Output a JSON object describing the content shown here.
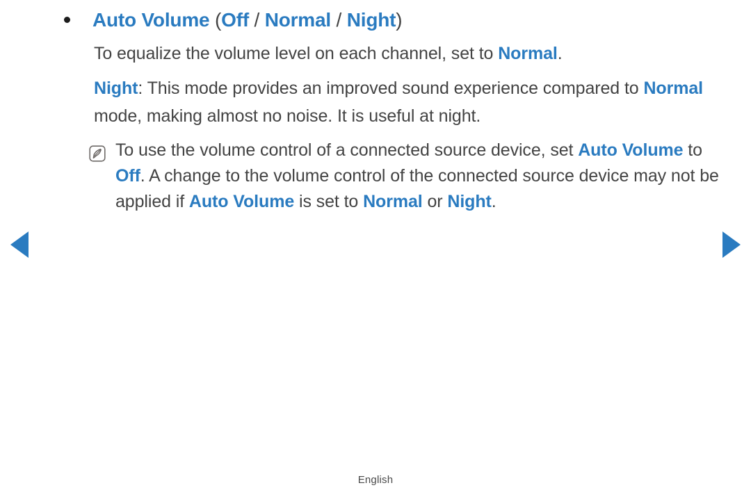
{
  "page": {
    "language_footer": "English",
    "accent_color": "#2a7bc0",
    "text_color": "#434343",
    "background_color": "#ffffff"
  },
  "bullet": {
    "dot": "•",
    "term": "Auto Volume",
    "open_paren": " (",
    "option_1": "Off",
    "sep_1": " / ",
    "option_2": "Normal",
    "sep_2": " / ",
    "option_3": "Night",
    "close_paren": ")"
  },
  "paragraphs": {
    "p1_pre": "To equalize the volume level on each channel, set to ",
    "p1_accent": "Normal",
    "p1_post": ".",
    "p2_accent_1": "Night",
    "p2_mid_1": ": This mode provides an improved sound experience compared to ",
    "p2_accent_2": "Normal",
    "p2_mid_2": " mode, making almost no noise. It is useful at night."
  },
  "note": {
    "icon": "note-pen-icon",
    "seg_1": "To use the volume control of a connected source device, set ",
    "accent_1": "Auto Volume",
    "seg_2": " to ",
    "accent_2": "Off",
    "seg_3": ". A change to the volume control of the connected source device may not be applied if ",
    "accent_3": "Auto Volume",
    "seg_4": " is set to ",
    "accent_4": "Normal",
    "seg_5": " or ",
    "accent_5": "Night",
    "seg_6": "."
  },
  "navigation": {
    "prev_label": "◀",
    "next_label": "▶"
  }
}
